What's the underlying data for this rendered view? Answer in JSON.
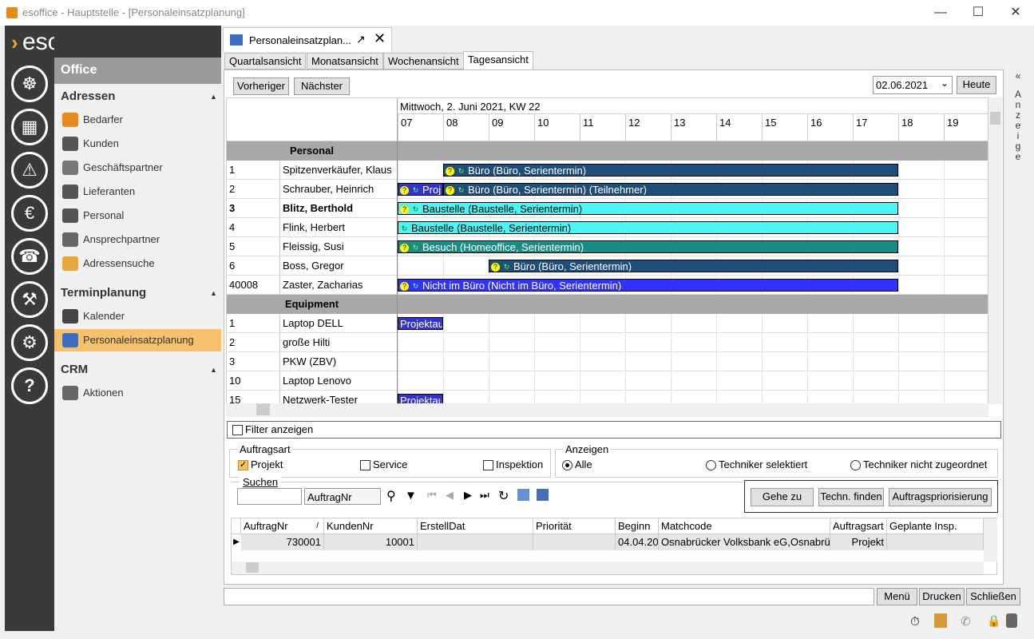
{
  "window": {
    "title": "esoffice - Hauptstelle - [Personaleinsatzplanung]"
  },
  "brand": "esoffice",
  "nav": {
    "office_label": "Office",
    "sections": [
      {
        "title": "Adressen",
        "items": [
          "Bedarfer",
          "Kunden",
          "Geschäftspartner",
          "Lieferanten",
          "Personal",
          "Ansprechpartner",
          "Adressensuche"
        ]
      },
      {
        "title": "Terminplanung",
        "items": [
          "Kalender",
          "Personaleinsatzplanung"
        ]
      },
      {
        "title": "CRM",
        "items": [
          "Aktionen"
        ]
      }
    ],
    "selected": "Personaleinsatzplanung"
  },
  "tab": {
    "label": "Personaleinsatzplan..."
  },
  "view_tabs": [
    "Quartalsansicht",
    "Monatsansicht",
    "Wochenansicht",
    "Tagesansicht"
  ],
  "active_view": "Tagesansicht",
  "toolbar": {
    "prev": "Vorheriger",
    "next": "Nächster",
    "date": "02.06.2021",
    "today": "Heute"
  },
  "right_strip": "Anzeige",
  "schedule": {
    "date_header": "Mittwoch, 2. Juni 2021, KW 22",
    "hours": [
      "07",
      "08",
      "09",
      "10",
      "11",
      "12",
      "13",
      "14",
      "15",
      "16",
      "17",
      "18",
      "19"
    ],
    "groups": [
      {
        "name": "Personal",
        "rows": [
          {
            "id": "1",
            "name": "Spitzenverkäufer, Klaus",
            "bold": false,
            "events": [
              {
                "label": "Büro (Büro, Serientermin)",
                "start": 8,
                "end": 18,
                "color": "#1f4e79",
                "icons": 2
              }
            ]
          },
          {
            "id": "2",
            "name": "Schrauber, Heinrich",
            "bold": false,
            "events": [
              {
                "label": "Proj",
                "start": 7,
                "end": 8,
                "color": "#3333cc",
                "icons": 2
              },
              {
                "label": "Büro (Büro, Serientermin) (Teilnehmer)",
                "start": 8,
                "end": 18,
                "color": "#1f4e79",
                "icons": 2
              }
            ]
          },
          {
            "id": "3",
            "name": "Blitz, Berthold",
            "bold": true,
            "events": [
              {
                "label": "Baustelle (Baustelle, Serientermin)",
                "start": 7,
                "end": 18,
                "color": "#4ff5f5",
                "icons": 2,
                "dark": true
              }
            ]
          },
          {
            "id": "4",
            "name": "Flink, Herbert",
            "bold": false,
            "events": [
              {
                "label": "Baustelle (Baustelle, Serientermin)",
                "start": 7,
                "end": 18,
                "color": "#4ff5f5",
                "icons": 1,
                "dark": true
              }
            ]
          },
          {
            "id": "5",
            "name": "Fleissig, Susi",
            "bold": false,
            "events": [
              {
                "label": "Besuch (Homeoffice, Serientermin)",
                "start": 7,
                "end": 18,
                "color": "#1a8c84",
                "icons": 2
              }
            ]
          },
          {
            "id": "6",
            "name": "Boss, Gregor",
            "bold": false,
            "events": [
              {
                "label": "Büro (Büro, Serientermin)",
                "start": 9,
                "end": 18,
                "color": "#1f4e79",
                "icons": 2
              }
            ]
          },
          {
            "id": "40008",
            "name": "Zaster, Zacharias",
            "bold": false,
            "events": [
              {
                "label": "Nicht im Büro (Nicht im Büro, Serientermin)",
                "start": 7,
                "end": 18,
                "color": "#3333ff",
                "icons": 2
              }
            ]
          }
        ]
      },
      {
        "name": "Equipment",
        "rows": [
          {
            "id": "1",
            "name": "Laptop DELL",
            "bold": false,
            "events": [
              {
                "label": "Projektau",
                "start": 7,
                "end": 8,
                "color": "#3333cc",
                "icons": 0
              }
            ]
          },
          {
            "id": "2",
            "name": "große Hilti",
            "bold": false,
            "events": []
          },
          {
            "id": "3",
            "name": "PKW (ZBV)",
            "bold": false,
            "events": []
          },
          {
            "id": "10",
            "name": "Laptop Lenovo",
            "bold": false,
            "events": []
          },
          {
            "id": "15",
            "name": "Netzwerk-Tester",
            "bold": false,
            "events": [
              {
                "label": "Projektau",
                "start": 7,
                "end": 8,
                "color": "#3333cc",
                "icons": 0
              }
            ]
          }
        ]
      }
    ]
  },
  "filter": {
    "show_label": "Filter anzeigen",
    "auftragsart_legend": "Auftragsart",
    "auftragsart": [
      {
        "label": "Projekt",
        "checked": true
      },
      {
        "label": "Service",
        "checked": false
      },
      {
        "label": "Inspektion",
        "checked": false
      }
    ],
    "anzeigen_legend": "Anzeigen",
    "anzeigen": [
      {
        "label": "Alle",
        "checked": true
      },
      {
        "label": "Techniker selektiert",
        "checked": false
      },
      {
        "label": "Techniker nicht zugeordnet",
        "checked": false
      }
    ],
    "suchen_legend": "Suchen",
    "search_value": "",
    "search_field": "AuftragNr",
    "actions": [
      "Gehe zu",
      "Techn. finden",
      "Auftragspriorisierung"
    ]
  },
  "orders": {
    "columns": [
      "AuftragNr",
      "KundenNr",
      "ErstellDat",
      "Priorität",
      "Beginn",
      "Matchcode",
      "Auftragsart",
      "Geplante Insp."
    ],
    "rows": [
      [
        "730001",
        "10001",
        "",
        "",
        "04.04.20",
        "Osnabrücker Volksbank eG,Osnabrüc",
        "Projekt",
        ""
      ]
    ]
  },
  "bottom_buttons": [
    "Menü",
    "Drucken",
    "Schließen"
  ]
}
